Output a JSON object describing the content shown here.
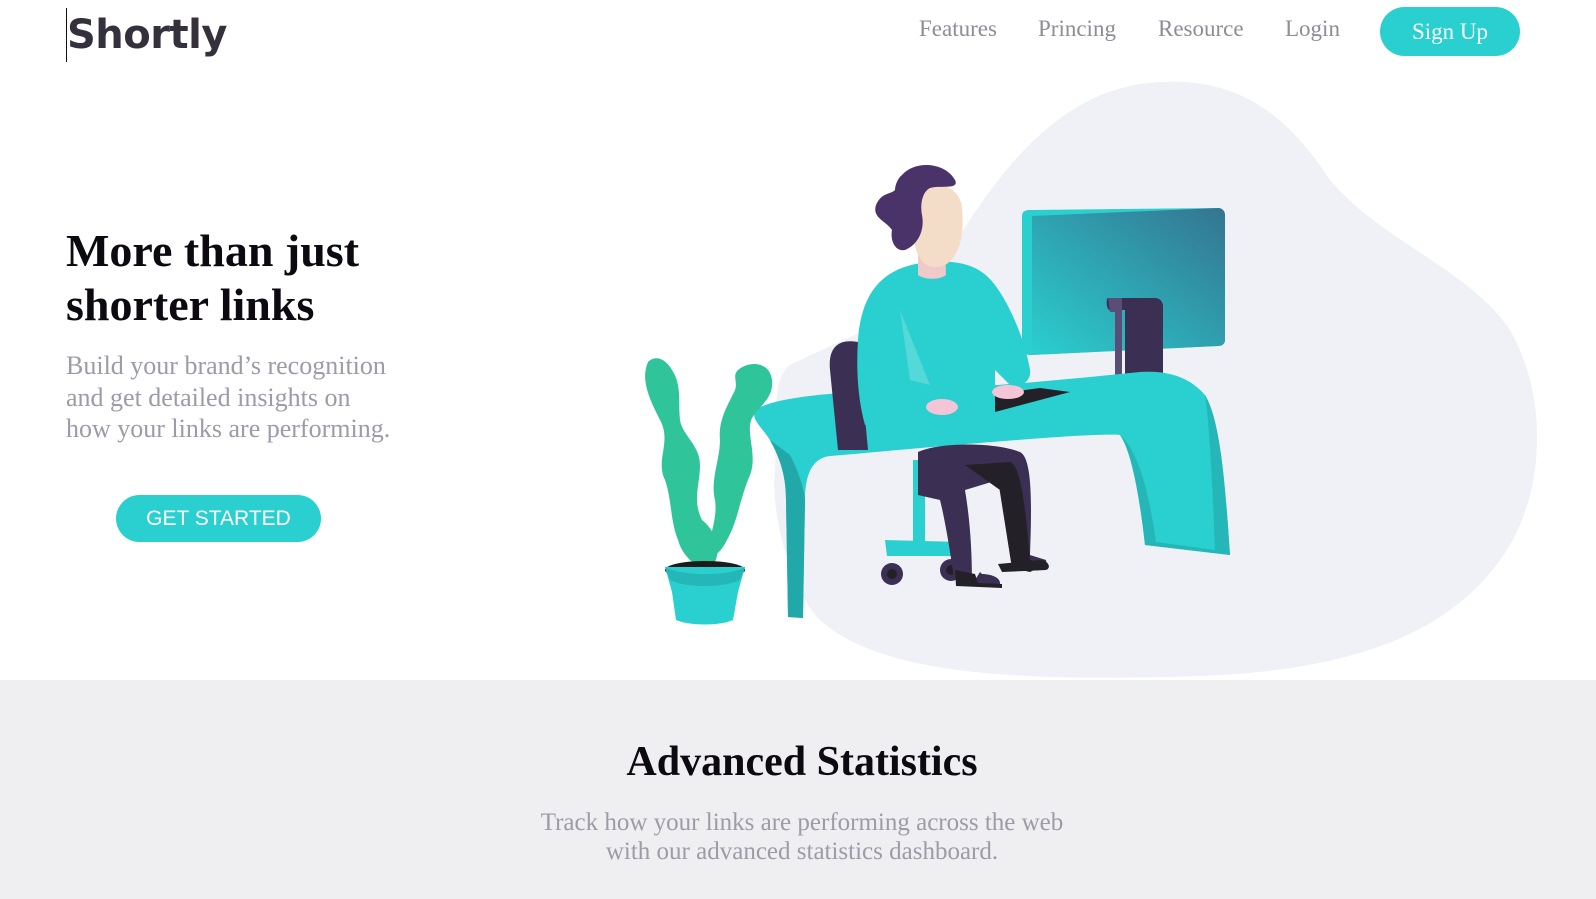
{
  "header": {
    "logo": "Shortly",
    "nav": [
      {
        "label": "Features"
      },
      {
        "label": "Princing"
      },
      {
        "label": "Resource"
      },
      {
        "label": "Login"
      }
    ],
    "signup_label": "Sign Up"
  },
  "hero": {
    "title": "More than just shorter links",
    "subtitle": "Build your brand’s recognition and get detailed insights on how your links are performing.",
    "cta_label": "GET STARTED",
    "illustration": "person-working-at-desk-illustration"
  },
  "stats": {
    "title": "Advanced Statistics",
    "subtitle_line1": "Track how your links are performing across the web",
    "subtitle_line2": "with our advanced statistics dashboard."
  },
  "colors": {
    "primary_cyan": "#2acfcf",
    "dark_violet": "#3b3054",
    "grayish_violet": "#9e9aa7",
    "very_dark_violet": "#232127",
    "light_gray_bg": "#efeff1"
  }
}
